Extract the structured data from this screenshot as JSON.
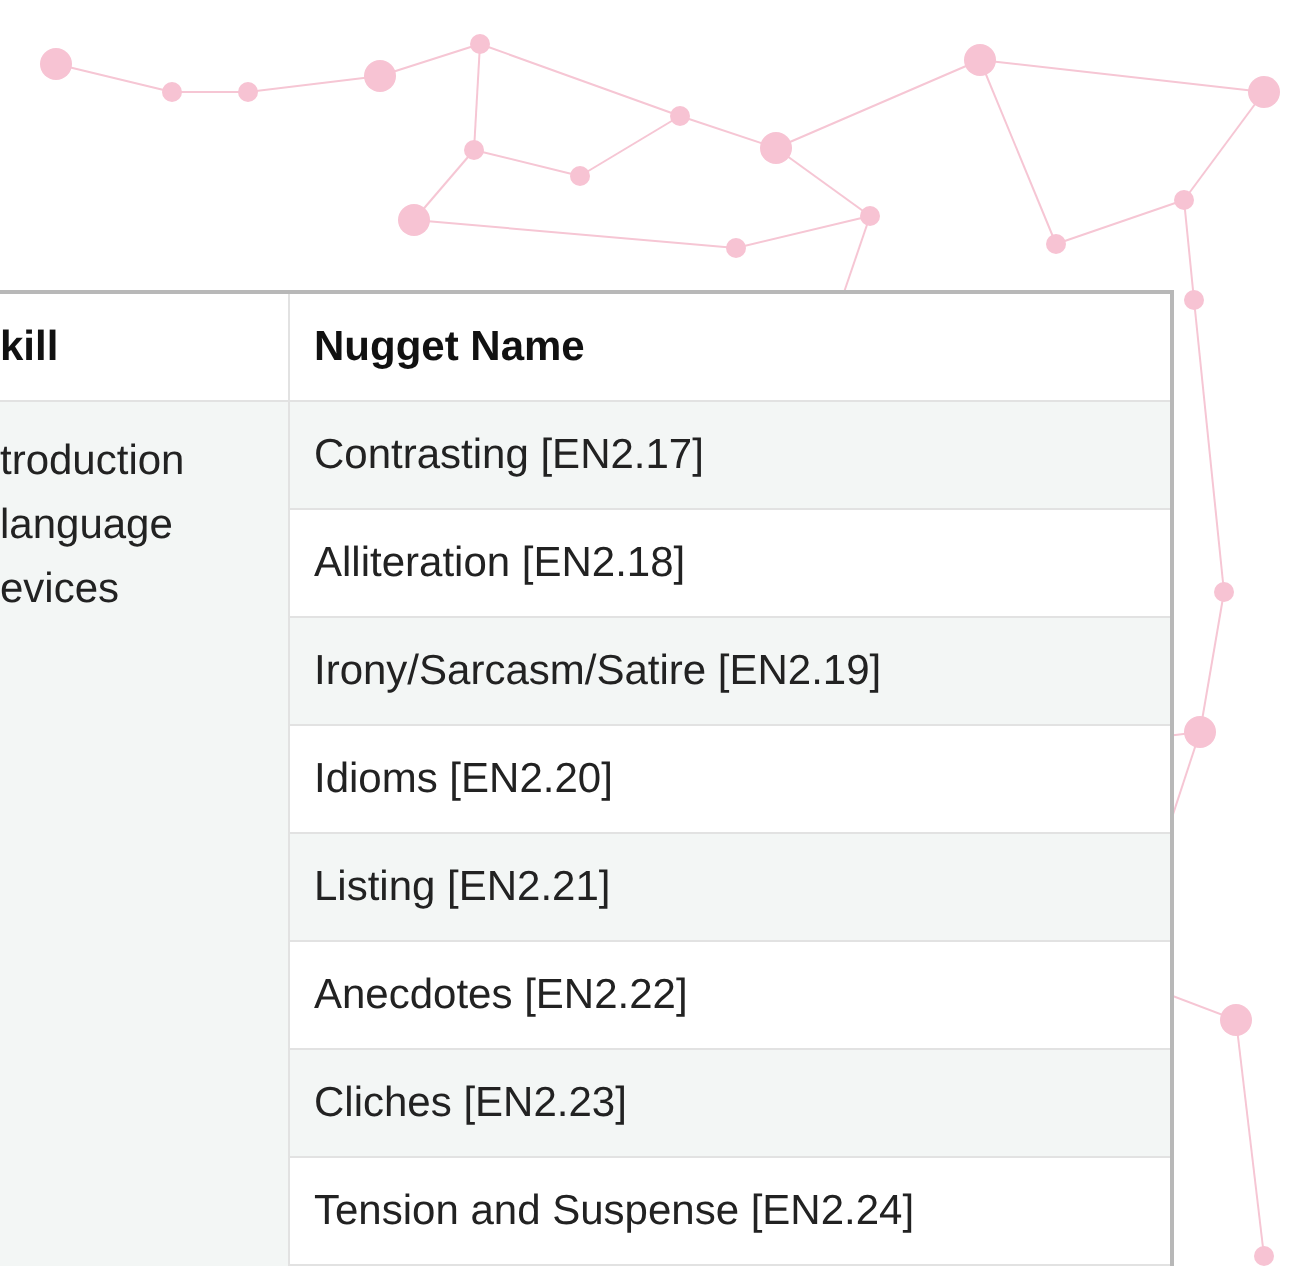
{
  "table": {
    "columns": [
      "kill",
      "Nugget Name"
    ],
    "skill": "troduction\nlanguage\nevices",
    "rows": [
      "Contrasting [EN2.17]",
      "Alliteration [EN2.18]",
      "Irony/Sarcasm/Satire [EN2.19]",
      "Idioms [EN2.20]",
      "Listing [EN2.21]",
      "Anecdotes [EN2.22]",
      "Cliches [EN2.23]",
      "Tension and Suspense [EN2.24]"
    ]
  }
}
